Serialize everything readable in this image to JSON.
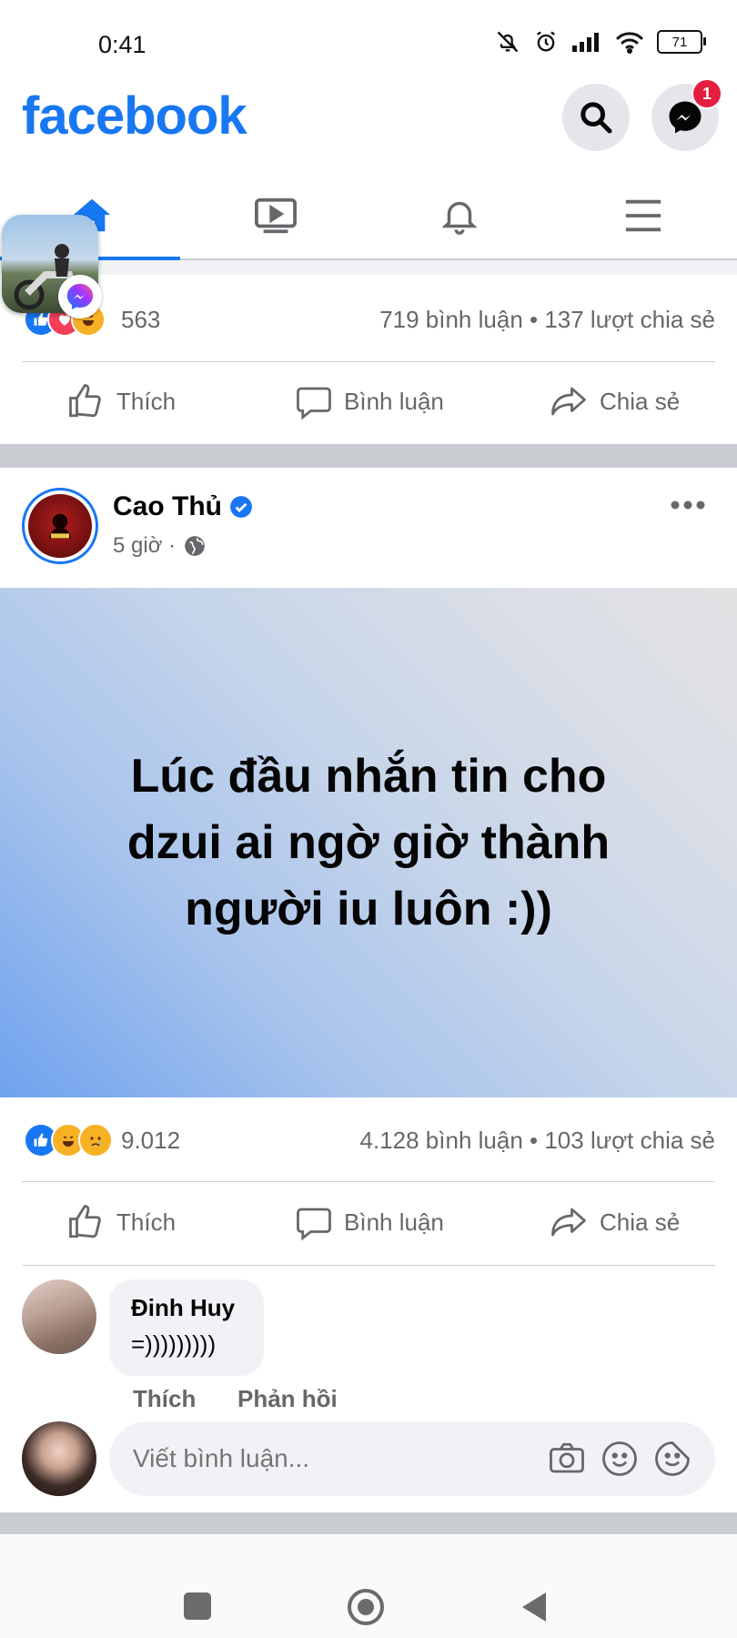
{
  "status_bar": {
    "time": "0:41",
    "battery": "71"
  },
  "header": {
    "logo": "facebook",
    "messenger_badge": "1"
  },
  "tabs": [
    {
      "name": "home",
      "active": true
    },
    {
      "name": "watch",
      "active": false
    },
    {
      "name": "notifications",
      "active": false
    },
    {
      "name": "menu",
      "active": false
    }
  ],
  "post1": {
    "reaction_count": "563",
    "stats": "719 bình luận • 137 lượt chia sẻ"
  },
  "actions": {
    "like": "Thích",
    "comment": "Bình luận",
    "share": "Chia sẻ"
  },
  "post2": {
    "author": "Cao Thủ",
    "verified": true,
    "time": "5 giờ ·",
    "text": "Lúc đầu nhắn tin cho\ndzui ai ngờ giờ thành\nngười iu luôn :))",
    "reaction_count": "9.012",
    "stats": "4.128 bình luận • 103 lượt chia sẻ"
  },
  "comment": {
    "author": "Đinh Huy",
    "text": "=)))))))))",
    "like": "Thích",
    "reply": "Phản hồi"
  },
  "write_comment": {
    "placeholder": "Viết bình luận..."
  },
  "colors": {
    "brand": "#1877f2",
    "badge": "#e41e3f",
    "text_secondary": "#65676b"
  }
}
